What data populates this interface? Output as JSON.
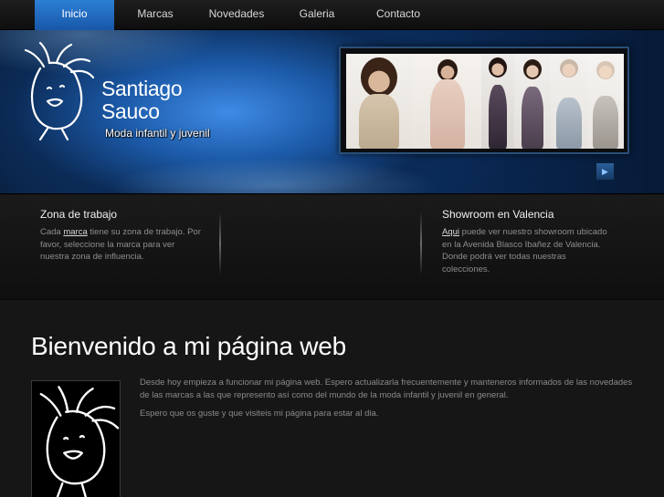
{
  "nav": {
    "items": [
      {
        "label": "Inicio",
        "active": true
      },
      {
        "label": "Marcas",
        "active": false
      },
      {
        "label": "Novedades",
        "active": false
      },
      {
        "label": "Galeria",
        "active": false
      },
      {
        "label": "Contacto",
        "active": false
      }
    ]
  },
  "header": {
    "brand_line1": "Santiago",
    "brand_line2": "Sauco",
    "tagline": "Moda infantil y juvenil",
    "logo_icon": "child-drawing-icon",
    "gallery_play_icon": "play-icon"
  },
  "info": {
    "work_zone": {
      "title": "Zona de trabajo",
      "text_before": "Cada ",
      "link": "marca",
      "text_after": " tiene su zona de trabajo. Por favor, seleccione la marca para ver nuestra zona de influencia."
    },
    "showroom": {
      "title": "Showroom en Valencia",
      "link": "Aqui",
      "text_after": " puede ver nuestro showroom ubicado en la Avenida Blasco Ibañez de Valencia. Donde podrá ver todas nuestras colecciones."
    }
  },
  "main": {
    "title": "Bienvenido a mi página web",
    "paragraph1": "Desde hoy empieza a funcionar mi página web. Espero actualizarla frecuentemente y manteneros informados de las novedades de las marcas a las que represento así como del mundo de la moda infantil y juvenil en general.",
    "paragraph2": "Espero que os guste y que visiteis mi página para estar al dia."
  },
  "colors": {
    "nav_active": "#1f6bc0",
    "header_blue": "#1c5aa8",
    "background": "#161616"
  }
}
